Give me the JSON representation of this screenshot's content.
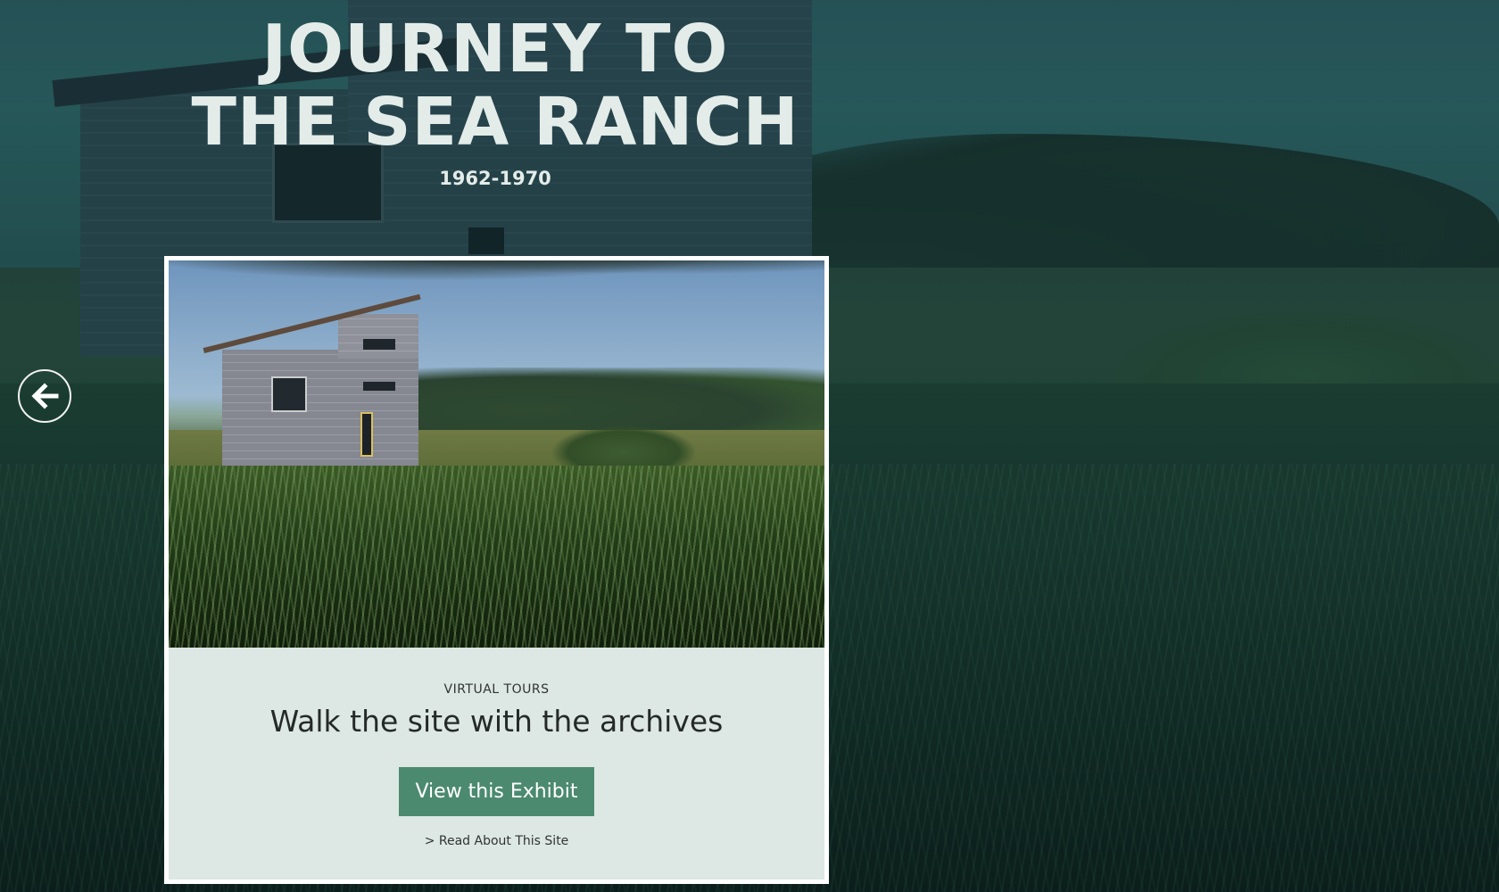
{
  "hero": {
    "title_line1": "JOURNEY TO",
    "title_line2": "THE SEA RANCH",
    "years": "1962-1970"
  },
  "nav": {
    "prev_icon": "arrow-left-icon"
  },
  "card": {
    "eyebrow": "VIRTUAL TOURS",
    "heading": "Walk the site with the archives",
    "cta_label": "View this Exhibit",
    "read_link": "> Read About This Site"
  },
  "colors": {
    "title": "#e3ece8",
    "cta_bg": "#4b8a6f",
    "card_bg": "#dde7e4"
  }
}
